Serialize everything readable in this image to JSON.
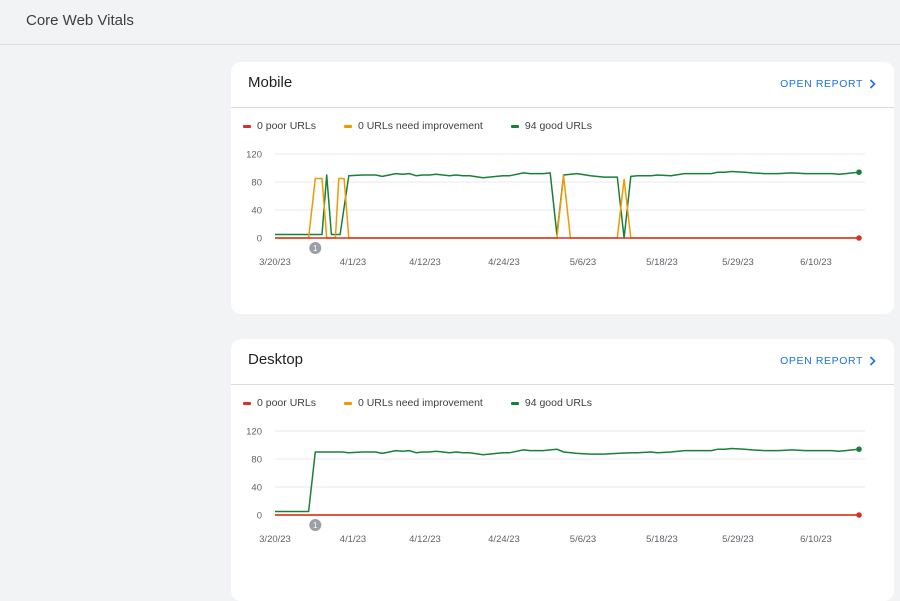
{
  "page": {
    "title": "Core Web Vitals"
  },
  "colors": {
    "poor": "#d93025",
    "needs_improvement": "#f29900",
    "good": "#188038",
    "link": "#1a73e8"
  },
  "cards": [
    {
      "title": "Mobile",
      "open_report_label": "OPEN REPORT",
      "legend": [
        {
          "label": "0 poor URLs",
          "color": "#d93025"
        },
        {
          "label": "0 URLs need improvement",
          "color": "#f29900"
        },
        {
          "label": "94 good URLs",
          "color": "#188038"
        }
      ],
      "annotation_label": "1"
    },
    {
      "title": "Desktop",
      "open_report_label": "OPEN REPORT",
      "legend": [
        {
          "label": "0 poor URLs",
          "color": "#d93025"
        },
        {
          "label": "0 URLs need improvement",
          "color": "#f29900"
        },
        {
          "label": "94 good URLs",
          "color": "#188038"
        }
      ],
      "annotation_label": "1"
    }
  ],
  "chart_data": [
    {
      "type": "line",
      "title": "Mobile",
      "x_ticks": [
        "3/20/23",
        "4/1/23",
        "4/12/23",
        "4/24/23",
        "5/6/23",
        "5/18/23",
        "5/29/23",
        "6/10/23"
      ],
      "y_ticks": [
        0,
        40,
        80,
        120
      ],
      "ylim": [
        0,
        120
      ],
      "x_range_days": [
        0,
        87
      ],
      "grid": true,
      "legend_position": "top-left",
      "annotations": [
        {
          "x_day": 6,
          "label": "1"
        }
      ],
      "series": [
        {
          "name": "poor URLs",
          "color": "#d93025",
          "points": [
            [
              0,
              0
            ],
            [
              87,
              0
            ]
          ]
        },
        {
          "name": "URLs need improvement",
          "color": "#f29900",
          "points": [
            [
              0,
              0
            ],
            [
              5,
              0
            ],
            [
              6,
              85
            ],
            [
              7,
              85
            ],
            [
              7.7,
              0
            ],
            [
              9,
              0
            ],
            [
              9.5,
              85
            ],
            [
              10.3,
              85
            ],
            [
              11,
              0
            ],
            [
              42,
              0
            ],
            [
              43,
              89
            ],
            [
              44,
              0
            ],
            [
              51,
              0
            ],
            [
              52,
              84
            ],
            [
              53,
              0
            ],
            [
              87,
              0
            ]
          ]
        },
        {
          "name": "good URLs",
          "color": "#188038",
          "points": [
            [
              0,
              5
            ],
            [
              5,
              5
            ],
            [
              7,
              5
            ],
            [
              7.7,
              90
            ],
            [
              8.4,
              5
            ],
            [
              9.7,
              5
            ],
            [
              11,
              89
            ],
            [
              13,
              90
            ],
            [
              15,
              90
            ],
            [
              16,
              88
            ],
            [
              17,
              90
            ],
            [
              18,
              92
            ],
            [
              19,
              91
            ],
            [
              20,
              92
            ],
            [
              21,
              89
            ],
            [
              22,
              90
            ],
            [
              23,
              90
            ],
            [
              24,
              91
            ],
            [
              25,
              90
            ],
            [
              26,
              89
            ],
            [
              27,
              90
            ],
            [
              28,
              89
            ],
            [
              29,
              89
            ],
            [
              31,
              86
            ],
            [
              33,
              88
            ],
            [
              34,
              89
            ],
            [
              35,
              89
            ],
            [
              37,
              93
            ],
            [
              38,
              92
            ],
            [
              40,
              92
            ],
            [
              41,
              93
            ],
            [
              42,
              5
            ],
            [
              43,
              90
            ],
            [
              45,
              92
            ],
            [
              47,
              89
            ],
            [
              49,
              87
            ],
            [
              51,
              87
            ],
            [
              52,
              0
            ],
            [
              53,
              88
            ],
            [
              54,
              89
            ],
            [
              56,
              89
            ],
            [
              57,
              90
            ],
            [
              59,
              89
            ],
            [
              61,
              92
            ],
            [
              63,
              92
            ],
            [
              65,
              92
            ],
            [
              66,
              94
            ],
            [
              67,
              94
            ],
            [
              68,
              95
            ],
            [
              70,
              94
            ],
            [
              71,
              93
            ],
            [
              73,
              92
            ],
            [
              75,
              92
            ],
            [
              77,
              93
            ],
            [
              79,
              92
            ],
            [
              81,
              92
            ],
            [
              83,
              92
            ],
            [
              84,
              91
            ],
            [
              85,
              92
            ],
            [
              86,
              93
            ],
            [
              87,
              94
            ]
          ]
        }
      ]
    },
    {
      "type": "line",
      "title": "Desktop",
      "x_ticks": [
        "3/20/23",
        "4/1/23",
        "4/12/23",
        "4/24/23",
        "5/6/23",
        "5/18/23",
        "5/29/23",
        "6/10/23"
      ],
      "y_ticks": [
        0,
        40,
        80,
        120
      ],
      "ylim": [
        0,
        120
      ],
      "x_range_days": [
        0,
        87
      ],
      "grid": true,
      "legend_position": "top-left",
      "annotations": [
        {
          "x_day": 6,
          "label": "1"
        }
      ],
      "series": [
        {
          "name": "poor URLs",
          "color": "#d93025",
          "points": [
            [
              0,
              0
            ],
            [
              87,
              0
            ]
          ]
        },
        {
          "name": "URLs need improvement",
          "color": "#f29900",
          "points": [
            [
              0,
              0
            ],
            [
              87,
              0
            ]
          ]
        },
        {
          "name": "good URLs",
          "color": "#188038",
          "points": [
            [
              0,
              5
            ],
            [
              5,
              5
            ],
            [
              6,
              90
            ],
            [
              8,
              90
            ],
            [
              10,
              90
            ],
            [
              11,
              89
            ],
            [
              13,
              90
            ],
            [
              15,
              90
            ],
            [
              16,
              88
            ],
            [
              17,
              90
            ],
            [
              18,
              92
            ],
            [
              19,
              91
            ],
            [
              20,
              92
            ],
            [
              21,
              89
            ],
            [
              22,
              90
            ],
            [
              23,
              90
            ],
            [
              24,
              91
            ],
            [
              25,
              90
            ],
            [
              26,
              89
            ],
            [
              27,
              90
            ],
            [
              28,
              89
            ],
            [
              29,
              89
            ],
            [
              31,
              86
            ],
            [
              33,
              88
            ],
            [
              34,
              89
            ],
            [
              35,
              89
            ],
            [
              37,
              93
            ],
            [
              38,
              92
            ],
            [
              40,
              92
            ],
            [
              41,
              93
            ],
            [
              42,
              94
            ],
            [
              43,
              90
            ],
            [
              45,
              88
            ],
            [
              47,
              87
            ],
            [
              49,
              87
            ],
            [
              51,
              88
            ],
            [
              53,
              89
            ],
            [
              54,
              89
            ],
            [
              56,
              90
            ],
            [
              57,
              89
            ],
            [
              59,
              90
            ],
            [
              61,
              92
            ],
            [
              63,
              92
            ],
            [
              65,
              92
            ],
            [
              66,
              94
            ],
            [
              67,
              94
            ],
            [
              68,
              95
            ],
            [
              70,
              94
            ],
            [
              71,
              93
            ],
            [
              73,
              92
            ],
            [
              75,
              92
            ],
            [
              77,
              93
            ],
            [
              79,
              92
            ],
            [
              81,
              92
            ],
            [
              83,
              92
            ],
            [
              84,
              91
            ],
            [
              85,
              92
            ],
            [
              86,
              93
            ],
            [
              87,
              94
            ]
          ]
        }
      ]
    }
  ]
}
